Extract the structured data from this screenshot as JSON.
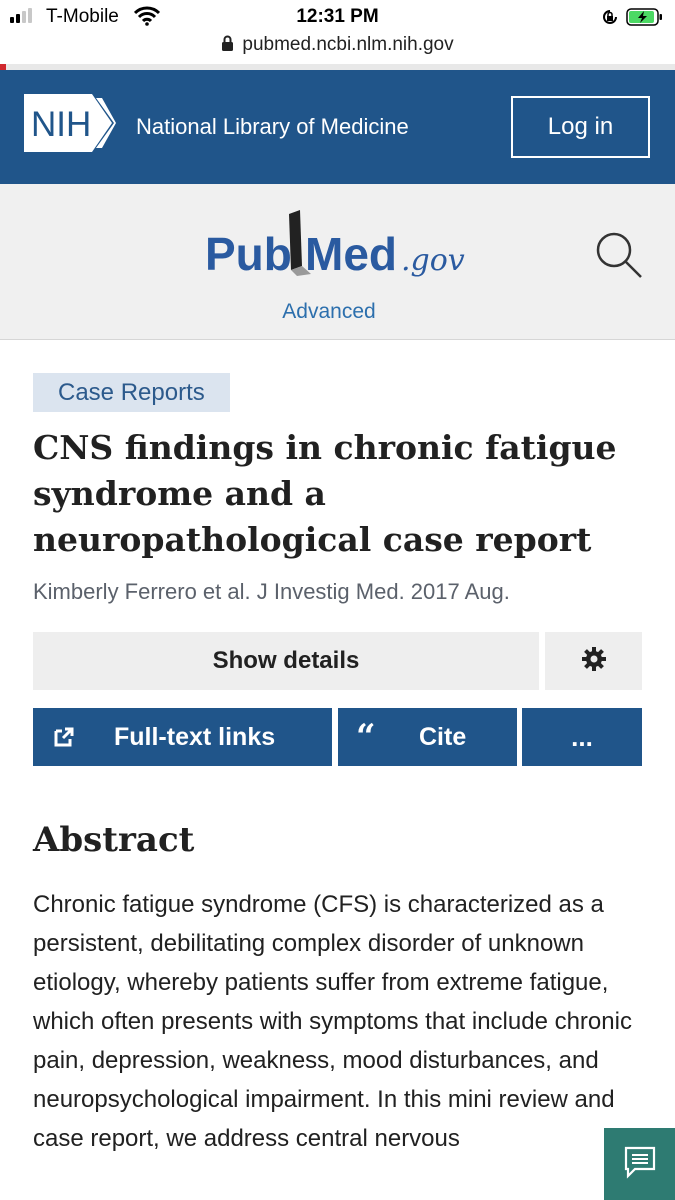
{
  "status_bar": {
    "carrier": "T-Mobile",
    "time": "12:31 PM",
    "signal_bars_active": 2,
    "signal_bars_total": 4,
    "battery_level": 0.85
  },
  "browser": {
    "url": "pubmed.ncbi.nlm.nih.gov"
  },
  "nih_header": {
    "logo_text": "NIH",
    "title": "National Library of Medicine",
    "login_label": "Log in"
  },
  "pubmed_header": {
    "logo_text_pub": "Pub",
    "logo_text_med": "Med",
    "logo_text_gov": ".gov",
    "advanced_label": "Advanced"
  },
  "article": {
    "publication_type": "Case Reports",
    "title": "CNS findings in chronic fatigue syndrome and a neuropathological case report",
    "meta": "Kimberly Ferrero et al. J Investig Med. 2017 Aug.",
    "show_details_label": "Show details",
    "fulltext_label": "Full-text links",
    "cite_label": "Cite",
    "more_label": "...",
    "abstract_heading": "Abstract",
    "abstract_text": "Chronic fatigue syndrome (CFS) is characterized as a persistent, debilitating complex disorder of unknown etiology, whereby patients suffer from extreme fatigue, which often presents with symptoms that include chronic pain, depression, weakness, mood disturbances, and neuropsychological impairment. In this mini review and case report, we address central nervous"
  },
  "colors": {
    "nih_blue": "#20558a",
    "link_blue": "#2c6fad",
    "feedback_green": "#2e7b72",
    "badge_bg": "#dbe4ef"
  },
  "icons": [
    "wifi-icon",
    "orientation-lock-icon",
    "battery-icon",
    "lock-icon",
    "search-icon",
    "gear-icon",
    "external-link-icon",
    "quote-icon",
    "feedback-icon"
  ]
}
